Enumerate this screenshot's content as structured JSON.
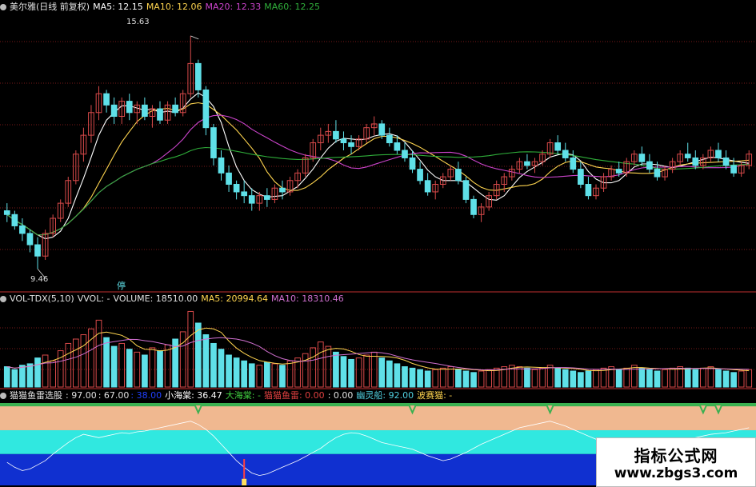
{
  "colors": {
    "ma5": "#ffffff",
    "ma10": "#ffd54f",
    "ma20": "#cc44cc",
    "ma60": "#2fae3a",
    "up": "#d94a4a",
    "down": "#5fe0e8",
    "grid": "#7a1a1a",
    "volma10": "#d070d0",
    "tail_red": "#ff4040",
    "tail_yellow": "#ffe060",
    "band_peach": "#f0b890",
    "band_cyan": "#30e8e0",
    "band_blue": "#1030d0",
    "band_green": "#3ab050",
    "sep": "#c03030"
  },
  "price_header": {
    "icon": "circle-icon",
    "name": "美尔雅(日线 前复权)",
    "ma5": "MA5: 12.15",
    "ma10": "MA10: 12.06",
    "ma20": "MA20: 12.33",
    "ma60": "MA60: 12.25"
  },
  "volume_header": {
    "title": "VOL-TDX(5,10)",
    "vvol": "VVOL: -",
    "volume": "VOLUME: 18510.00",
    "ma5": "MA5: 20994.64",
    "ma10": "MA10: 18310.46"
  },
  "indicator_header": {
    "title": "猫猫鱼雷选股",
    "v1": ": 97.00",
    "v2": ": 67.00",
    "v3": ": 38.00",
    "xiaohaitang_label": "小海棠",
    "xiaohaitang": ": 36.47",
    "dahaitang": "大海棠: -",
    "maomao_label": "猫猫鱼雷",
    "maomao_a": ": 0.00",
    "maomao_b": ": 0.00",
    "youlingchuan": "幽灵船: 92.00",
    "bosaimao": "波赛猫: -"
  },
  "watermark": {
    "line1": "指标公式网",
    "line2": "www.zbgs3.com"
  },
  "chart_data": [
    {
      "type": "candlestick",
      "title": "美尔雅(日线 前复权)",
      "price_high_label": "15.63",
      "price_low_label": "9.46",
      "marker_label": "停",
      "ylim": [
        9.0,
        16.2
      ],
      "candles": [
        [
          11.0,
          11.2,
          10.7,
          10.9
        ],
        [
          10.9,
          11.0,
          10.5,
          10.6
        ],
        [
          10.6,
          10.8,
          10.2,
          10.4
        ],
        [
          10.4,
          10.5,
          9.9,
          10.1
        ],
        [
          10.1,
          10.3,
          9.46,
          9.8
        ],
        [
          9.8,
          10.5,
          9.7,
          10.4
        ],
        [
          10.4,
          10.9,
          10.3,
          10.8
        ],
        [
          10.8,
          11.3,
          10.7,
          11.2
        ],
        [
          11.2,
          11.9,
          11.1,
          11.8
        ],
        [
          11.8,
          12.6,
          11.7,
          12.5
        ],
        [
          12.5,
          13.2,
          12.3,
          13.0
        ],
        [
          13.0,
          13.8,
          12.8,
          13.6
        ],
        [
          13.6,
          14.3,
          13.4,
          14.1
        ],
        [
          14.1,
          14.2,
          13.6,
          13.8
        ],
        [
          13.8,
          14.0,
          13.3,
          13.5
        ],
        [
          13.5,
          14.0,
          13.3,
          13.9
        ],
        [
          13.9,
          14.1,
          13.4,
          13.6
        ],
        [
          13.6,
          13.9,
          13.3,
          13.8
        ],
        [
          13.8,
          14.0,
          13.4,
          13.5
        ],
        [
          13.5,
          13.8,
          13.2,
          13.7
        ],
        [
          13.7,
          13.9,
          13.3,
          13.4
        ],
        [
          13.4,
          13.9,
          13.3,
          13.8
        ],
        [
          13.8,
          14.0,
          13.5,
          13.6
        ],
        [
          13.6,
          14.2,
          13.5,
          14.1
        ],
        [
          14.1,
          15.63,
          14.0,
          14.9
        ],
        [
          14.9,
          15.0,
          14.0,
          14.2
        ],
        [
          14.2,
          14.3,
          13.0,
          13.2
        ],
        [
          13.2,
          13.3,
          12.2,
          12.4
        ],
        [
          12.4,
          12.6,
          11.8,
          12.0
        ],
        [
          12.0,
          12.2,
          11.5,
          11.7
        ],
        [
          11.7,
          11.8,
          11.3,
          11.5
        ],
        [
          11.5,
          11.8,
          11.2,
          11.4
        ],
        [
          11.4,
          11.6,
          11.0,
          11.2
        ],
        [
          11.2,
          11.5,
          11.0,
          11.4
        ],
        [
          11.4,
          11.6,
          11.1,
          11.3
        ],
        [
          11.3,
          11.7,
          11.2,
          11.6
        ],
        [
          11.6,
          11.8,
          11.3,
          11.5
        ],
        [
          11.5,
          11.9,
          11.4,
          11.8
        ],
        [
          11.8,
          12.1,
          11.6,
          12.0
        ],
        [
          12.0,
          12.5,
          11.9,
          12.4
        ],
        [
          12.4,
          12.9,
          12.3,
          12.8
        ],
        [
          12.8,
          13.2,
          12.6,
          13.0
        ],
        [
          13.0,
          13.3,
          12.8,
          13.1
        ],
        [
          13.1,
          13.4,
          12.8,
          12.9
        ],
        [
          12.9,
          13.1,
          12.6,
          12.8
        ],
        [
          12.8,
          13.0,
          12.5,
          12.7
        ],
        [
          12.7,
          13.0,
          12.6,
          12.9
        ],
        [
          12.9,
          13.3,
          12.8,
          13.2
        ],
        [
          13.2,
          13.5,
          13.0,
          13.3
        ],
        [
          13.3,
          13.4,
          12.9,
          13.0
        ],
        [
          13.0,
          13.2,
          12.7,
          12.8
        ],
        [
          12.8,
          13.0,
          12.5,
          12.6
        ],
        [
          12.6,
          12.8,
          12.3,
          12.4
        ],
        [
          12.4,
          12.6,
          12.0,
          12.1
        ],
        [
          12.1,
          12.3,
          11.7,
          11.8
        ],
        [
          11.8,
          12.0,
          11.4,
          11.5
        ],
        [
          11.5,
          11.8,
          11.3,
          11.7
        ],
        [
          11.7,
          12.0,
          11.6,
          11.9
        ],
        [
          11.9,
          12.2,
          11.8,
          12.1
        ],
        [
          12.1,
          12.3,
          11.7,
          11.8
        ],
        [
          11.8,
          11.9,
          11.2,
          11.3
        ],
        [
          11.3,
          11.4,
          10.8,
          10.9
        ],
        [
          10.9,
          11.2,
          10.7,
          11.1
        ],
        [
          11.1,
          11.5,
          11.0,
          11.4
        ],
        [
          11.4,
          11.8,
          11.3,
          11.7
        ],
        [
          11.7,
          12.0,
          11.5,
          11.9
        ],
        [
          11.9,
          12.2,
          11.8,
          12.1
        ],
        [
          12.1,
          12.4,
          12.0,
          12.3
        ],
        [
          12.3,
          12.5,
          12.1,
          12.2
        ],
        [
          12.2,
          12.4,
          12.0,
          12.3
        ],
        [
          12.3,
          12.6,
          12.2,
          12.5
        ],
        [
          12.5,
          12.9,
          12.4,
          12.8
        ],
        [
          12.8,
          13.0,
          12.5,
          12.6
        ],
        [
          12.6,
          12.8,
          12.3,
          12.4
        ],
        [
          12.4,
          12.6,
          12.0,
          12.1
        ],
        [
          12.1,
          12.3,
          11.6,
          11.7
        ],
        [
          11.7,
          11.9,
          11.3,
          11.4
        ],
        [
          11.4,
          11.7,
          11.3,
          11.6
        ],
        [
          11.6,
          12.0,
          11.5,
          11.9
        ],
        [
          11.9,
          12.2,
          11.8,
          12.1
        ],
        [
          12.1,
          12.3,
          11.9,
          12.0
        ],
        [
          12.0,
          12.4,
          11.9,
          12.3
        ],
        [
          12.3,
          12.6,
          12.2,
          12.5
        ],
        [
          12.5,
          12.7,
          12.2,
          12.3
        ],
        [
          12.3,
          12.5,
          12.0,
          12.1
        ],
        [
          12.1,
          12.3,
          11.8,
          11.9
        ],
        [
          11.9,
          12.2,
          11.8,
          12.1
        ],
        [
          12.1,
          12.4,
          12.0,
          12.3
        ],
        [
          12.3,
          12.6,
          12.2,
          12.5
        ],
        [
          12.5,
          12.8,
          12.3,
          12.4
        ],
        [
          12.4,
          12.6,
          12.1,
          12.2
        ],
        [
          12.2,
          12.5,
          12.1,
          12.4
        ],
        [
          12.4,
          12.7,
          12.3,
          12.6
        ],
        [
          12.6,
          12.8,
          12.3,
          12.4
        ],
        [
          12.4,
          12.6,
          12.1,
          12.2
        ],
        [
          12.2,
          12.4,
          11.9,
          12.0
        ],
        [
          12.0,
          12.3,
          11.9,
          12.2
        ],
        [
          12.2,
          12.6,
          12.1,
          12.5
        ]
      ],
      "ma_series": [
        {
          "name": "MA5"
        },
        {
          "name": "MA10"
        },
        {
          "name": "MA20"
        },
        {
          "name": "MA60"
        }
      ]
    },
    {
      "type": "bar",
      "title": "VOL-TDX(5,10)",
      "ylim": [
        0,
        55000
      ],
      "values": [
        14000,
        12000,
        15000,
        16000,
        20000,
        22000,
        18000,
        25000,
        30000,
        33000,
        36000,
        40000,
        46000,
        34000,
        28000,
        30000,
        26000,
        24000,
        22000,
        27000,
        25000,
        29000,
        33000,
        38000,
        52000,
        44000,
        36000,
        30000,
        26000,
        22000,
        20000,
        18000,
        16000,
        15000,
        17000,
        16000,
        15000,
        18000,
        20000,
        23000,
        27000,
        31000,
        28000,
        24000,
        21000,
        19000,
        20000,
        22000,
        24000,
        20000,
        18000,
        16000,
        14000,
        13000,
        12000,
        11000,
        12000,
        13000,
        14000,
        12000,
        11000,
        10000,
        11000,
        12000,
        13000,
        14000,
        15000,
        14000,
        13000,
        12000,
        13000,
        15000,
        13000,
        12000,
        11000,
        10000,
        11000,
        12000,
        13000,
        14000,
        12000,
        13000,
        15000,
        13000,
        12000,
        11000,
        12000,
        13000,
        14000,
        13000,
        12000,
        13000,
        14000,
        12000,
        11000,
        10000,
        11000,
        12000
      ]
    },
    {
      "type": "line",
      "title": "猫猫鱼雷选股",
      "ylim": [
        0,
        100
      ],
      "bands": [
        97,
        67,
        38
      ],
      "series": [
        {
          "name": "小海棠",
          "values": [
            28,
            22,
            18,
            20,
            25,
            30,
            38,
            45,
            52,
            58,
            62,
            60,
            58,
            60,
            62,
            64,
            63,
            65,
            66,
            68,
            70,
            72,
            74,
            76,
            78,
            74,
            68,
            60,
            50,
            40,
            30,
            22,
            15,
            12,
            14,
            18,
            22,
            26,
            30,
            35,
            40,
            45,
            52,
            58,
            62,
            64,
            63,
            60,
            56,
            52,
            50,
            48,
            46,
            44,
            40,
            36,
            33,
            30,
            32,
            36,
            40,
            45,
            50,
            54,
            58,
            62,
            66,
            70,
            72,
            74,
            76,
            78,
            75,
            72,
            68,
            64,
            60,
            56,
            52,
            48,
            45,
            42,
            40,
            42,
            45,
            48,
            50,
            52,
            54,
            56,
            58,
            60,
            62,
            63,
            64,
            66,
            68,
            70
          ]
        }
      ]
    }
  ]
}
